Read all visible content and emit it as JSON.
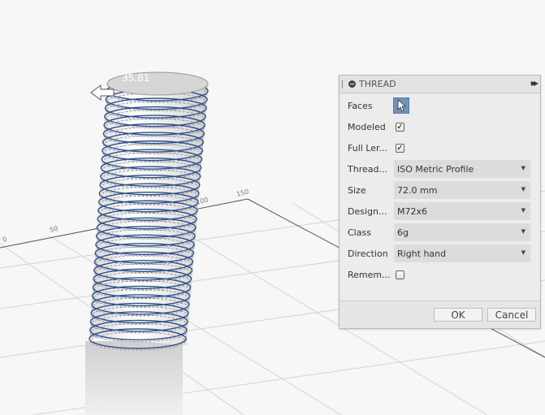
{
  "viewport": {
    "dimension_readout": "35.81",
    "grid_labels": [
      "0",
      "50",
      "100",
      "150"
    ]
  },
  "panel": {
    "title": "THREAD",
    "header_icons": {
      "collapse": "minus-circle-icon",
      "expand": "fast-forward-icon"
    },
    "rows": {
      "faces": {
        "label": "Faces",
        "selected": true,
        "icon": "cursor-arrow-icon"
      },
      "modeled": {
        "label": "Modeled",
        "checked": true,
        "mark": "✓"
      },
      "full_length": {
        "label": "Full Ler...",
        "checked": true,
        "mark": "✓"
      },
      "thread_type": {
        "label": "Thread...",
        "value": "ISO Metric Profile"
      },
      "size": {
        "label": "Size",
        "value": "72.0 mm"
      },
      "designation": {
        "label": "Design...",
        "value": "M72x6"
      },
      "class": {
        "label": "Class",
        "value": "6g"
      },
      "direction": {
        "label": "Direction",
        "value": "Right hand"
      },
      "remember": {
        "label": "Remem...",
        "checked": false,
        "mark": ""
      }
    },
    "buttons": {
      "ok": "OK",
      "cancel": "Cancel"
    }
  },
  "colors": {
    "selection": "#6f94b9",
    "thread_edge": "#2c4f8a"
  }
}
